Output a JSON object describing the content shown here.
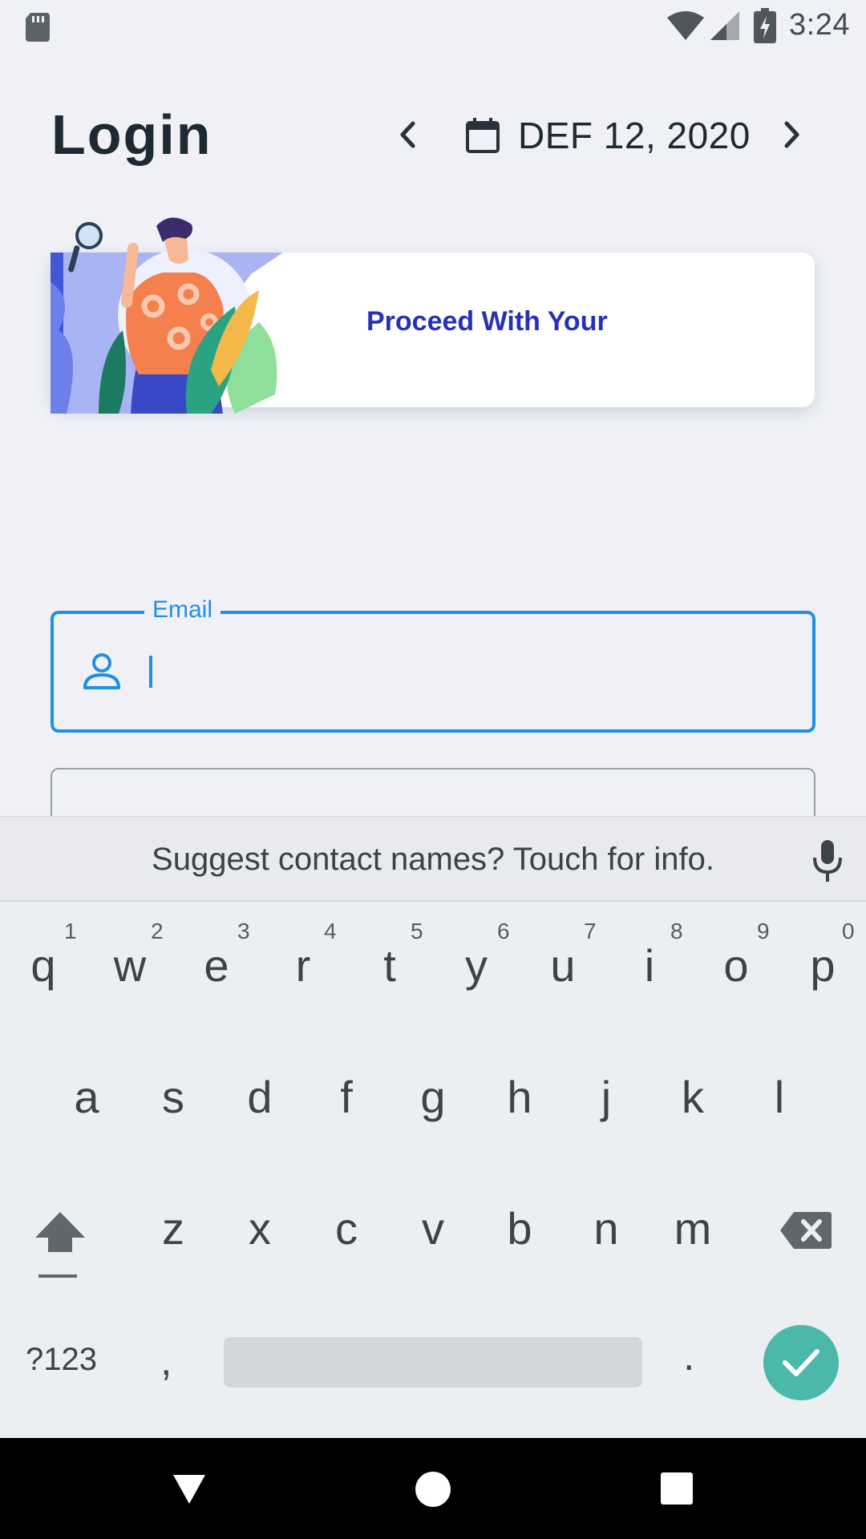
{
  "status_bar": {
    "time": "3:24"
  },
  "header": {
    "title": "Login",
    "date": "DEF 12, 2020"
  },
  "banner": {
    "text": "Proceed With Your"
  },
  "form": {
    "email": {
      "label": "Email",
      "value": "",
      "placeholder": ""
    }
  },
  "keyboard": {
    "suggestion": "Suggest contact names? Touch for info.",
    "row1": [
      "q",
      "w",
      "e",
      "r",
      "t",
      "y",
      "u",
      "i",
      "o",
      "p"
    ],
    "row1_hints": [
      "1",
      "2",
      "3",
      "4",
      "5",
      "6",
      "7",
      "8",
      "9",
      "0"
    ],
    "row2": [
      "a",
      "s",
      "d",
      "f",
      "g",
      "h",
      "j",
      "k",
      "l"
    ],
    "row3": [
      "z",
      "x",
      "c",
      "v",
      "b",
      "n",
      "m"
    ],
    "symbols_label": "?123",
    "comma": ",",
    "period": "."
  },
  "colors": {
    "accent": "#2190e3",
    "banner_text": "#2731b5",
    "enter_key": "#4bb8a9"
  },
  "icons": {
    "status": [
      "sd-card-icon",
      "wifi-icon",
      "signal-icon",
      "battery-charging-icon"
    ],
    "header": [
      "chevron-left-icon",
      "calendar-icon",
      "chevron-right-icon"
    ],
    "email": "person-icon",
    "keyboard": [
      "mic-icon",
      "shift-icon",
      "backspace-icon",
      "check-icon"
    ],
    "nav": [
      "back-icon",
      "home-icon",
      "recents-icon"
    ]
  }
}
